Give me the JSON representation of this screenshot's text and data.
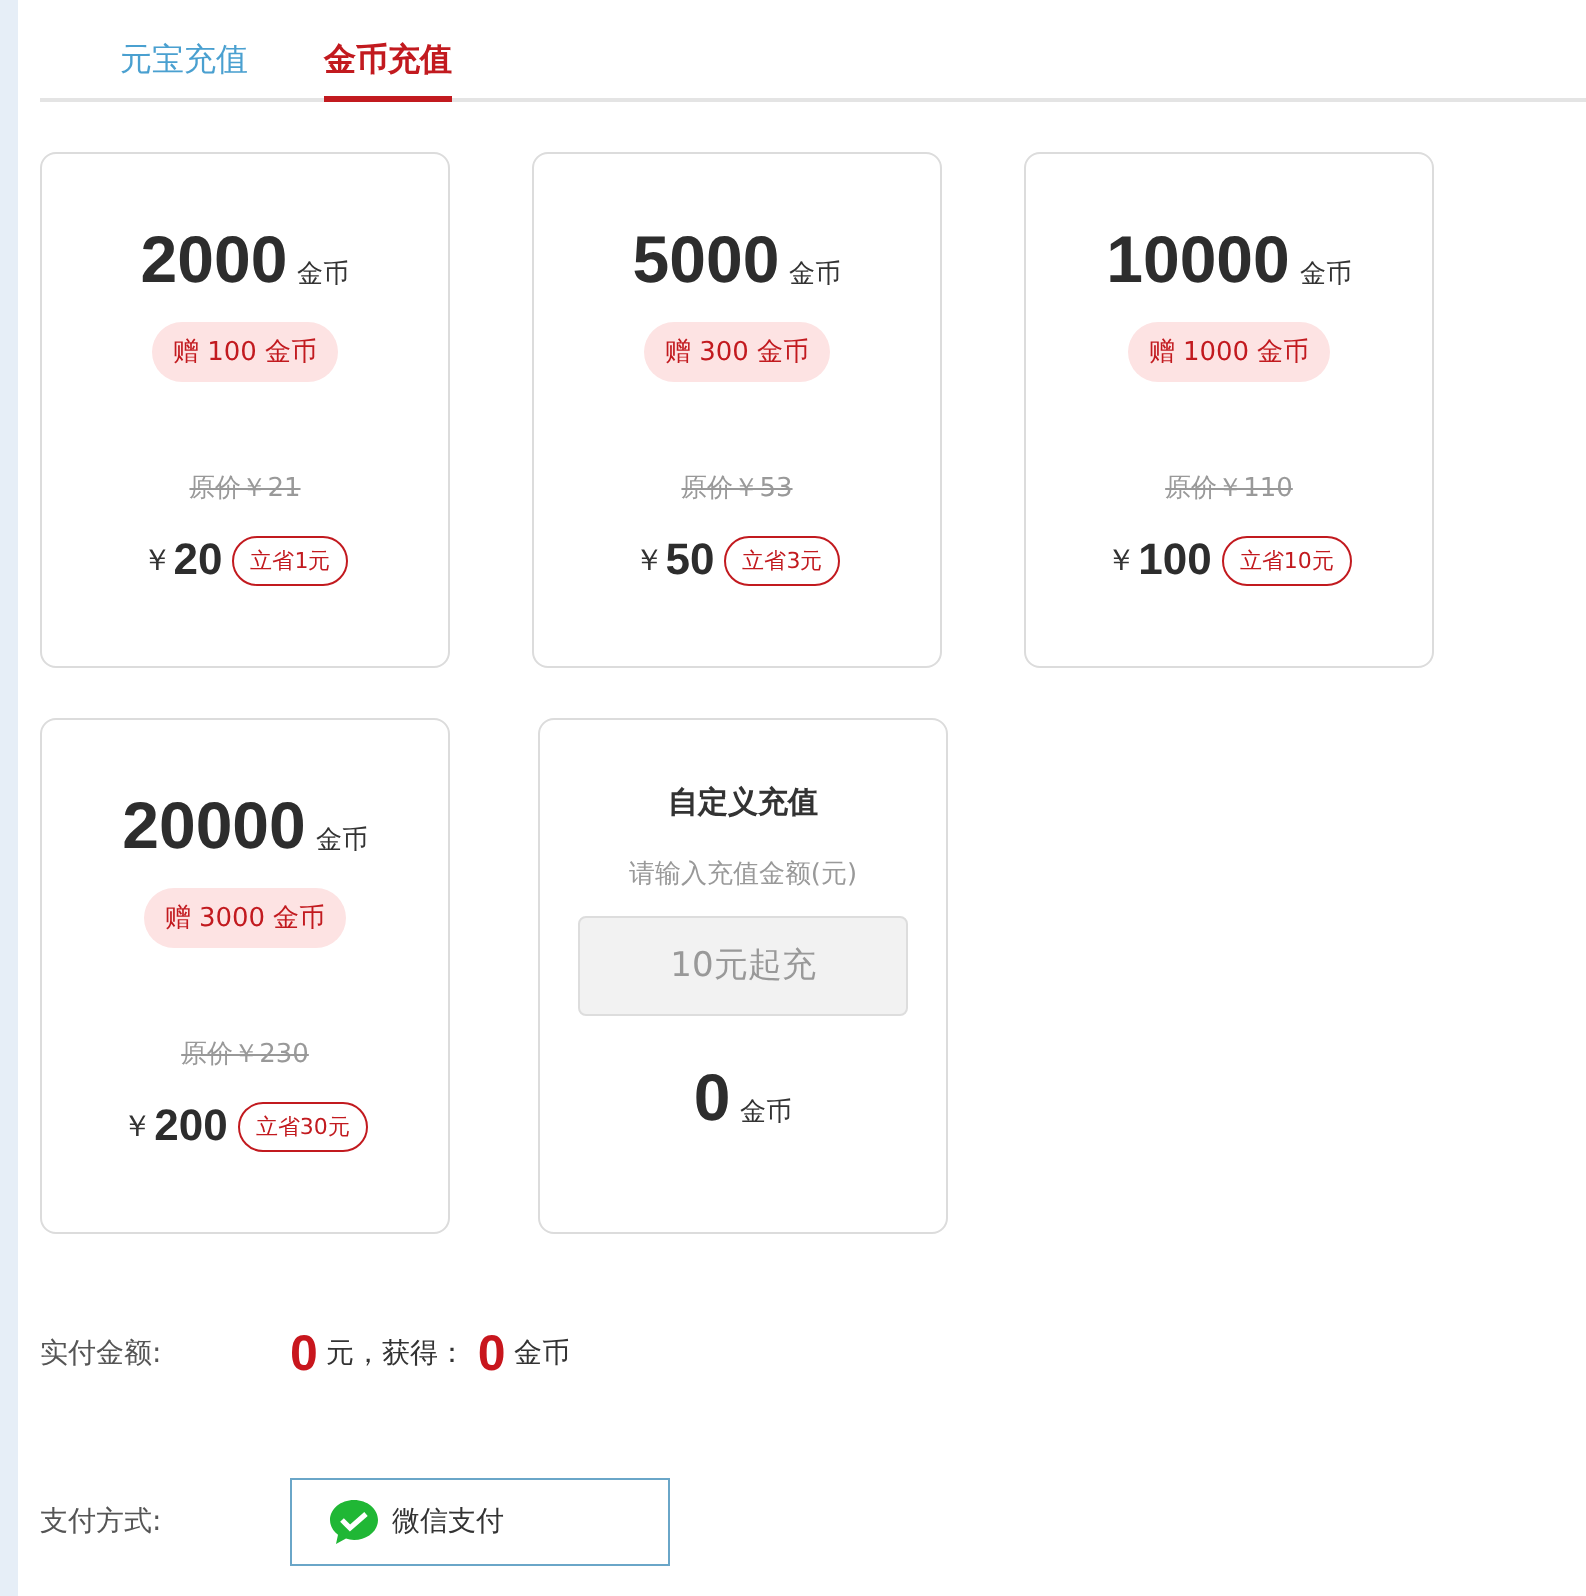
{
  "tabs": [
    {
      "label": "元宝充值",
      "selected": false
    },
    {
      "label": "金币充值",
      "selected": true
    }
  ],
  "packages": [
    {
      "amount": "2000",
      "unit": "金币",
      "bonus": "赠 100 金币",
      "original_price": "原价￥21",
      "currency": "￥",
      "price": "20",
      "saving": "立省1元"
    },
    {
      "amount": "5000",
      "unit": "金币",
      "bonus": "赠 300 金币",
      "original_price": "原价￥53",
      "currency": "￥",
      "price": "50",
      "saving": "立省3元"
    },
    {
      "amount": "10000",
      "unit": "金币",
      "bonus": "赠 1000 金币",
      "original_price": "原价￥110",
      "currency": "￥",
      "price": "100",
      "saving": "立省10元"
    },
    {
      "amount": "20000",
      "unit": "金币",
      "bonus": "赠 3000 金币",
      "original_price": "原价￥230",
      "currency": "￥",
      "price": "200",
      "saving": "立省30元"
    }
  ],
  "custom": {
    "title": "自定义充值",
    "hint": "请输入充值金额(元)",
    "placeholder": "10元起充",
    "amount": "0",
    "unit": "金币"
  },
  "summary": {
    "label": "实付金额:",
    "pay": "0",
    "pay_unit": "元，获得：",
    "coins": "0",
    "coins_unit": "金币"
  },
  "payment": {
    "label": "支付方式:",
    "option": "微信支付"
  }
}
